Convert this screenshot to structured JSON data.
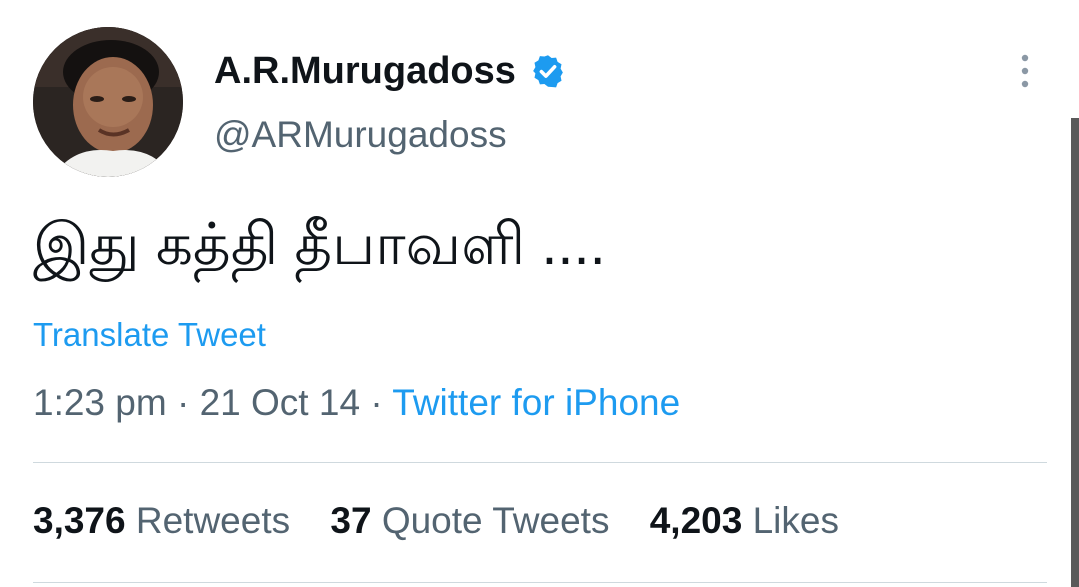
{
  "author": {
    "display_name": "A.R.Murugadoss",
    "handle": "@ARMurugadoss",
    "verified": true,
    "avatar_icon": "profile-photo"
  },
  "tweet": {
    "text": "இது கத்தி தீபாவளி ....",
    "translate_label": "Translate Tweet",
    "time": "1:23 pm",
    "date": "21 Oct 14",
    "separator": "·",
    "source": "Twitter for iPhone"
  },
  "stats": {
    "retweets_count": "3,376",
    "retweets_label": "Retweets",
    "quotes_count": "37",
    "quotes_label": "Quote Tweets",
    "likes_count": "4,203",
    "likes_label": "Likes"
  },
  "icons": {
    "verified": "verified-badge-icon",
    "more": "more-vertical-icon"
  },
  "colors": {
    "link": "#1d9bf0",
    "secondary_text": "#536471",
    "primary_text": "#0f1419",
    "divider": "#cfd9de"
  }
}
